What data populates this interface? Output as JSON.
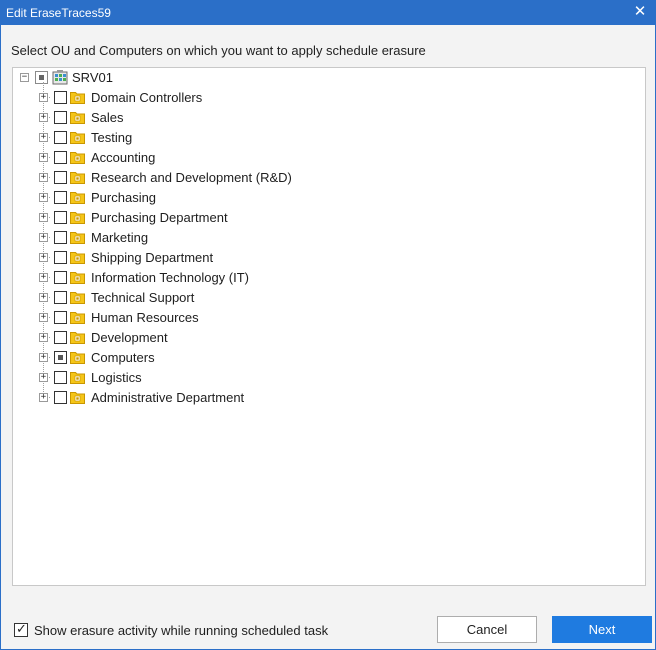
{
  "window": {
    "title": "Edit EraseTraces59",
    "close_glyph": "✕",
    "title_bar_color": "#2b6fc8"
  },
  "instruction": "Select OU and Computers on which you want to apply schedule erasure",
  "tree": {
    "root": {
      "label": "SRV01",
      "icon": "server-icon",
      "expander": "−",
      "state": "partial"
    },
    "items": [
      {
        "label": "Domain Controllers",
        "state": "unchecked"
      },
      {
        "label": "Sales",
        "state": "unchecked"
      },
      {
        "label": "Testing",
        "state": "unchecked"
      },
      {
        "label": "Accounting",
        "state": "unchecked"
      },
      {
        "label": "Research and Development (R&D)",
        "state": "unchecked"
      },
      {
        "label": "Purchasing",
        "state": "unchecked"
      },
      {
        "label": "Purchasing Department",
        "state": "unchecked"
      },
      {
        "label": "Marketing",
        "state": "unchecked"
      },
      {
        "label": "Shipping Department",
        "state": "unchecked"
      },
      {
        "label": "Information Technology (IT)",
        "state": "unchecked"
      },
      {
        "label": "Technical Support",
        "state": "unchecked"
      },
      {
        "label": "Human Resources",
        "state": "unchecked"
      },
      {
        "label": "Development",
        "state": "unchecked"
      },
      {
        "label": "Computers",
        "state": "partial"
      },
      {
        "label": "Logistics",
        "state": "unchecked"
      },
      {
        "label": "Administrative Department",
        "state": "unchecked"
      }
    ],
    "item_expander": "+",
    "item_icon": "folder-icon"
  },
  "footer": {
    "show_activity_label": "Show erasure activity while running scheduled task",
    "show_activity_checked": true,
    "check_glyph": "✓",
    "cancel_label": "Cancel",
    "next_label": "Next",
    "accent_color": "#1f7be0"
  }
}
